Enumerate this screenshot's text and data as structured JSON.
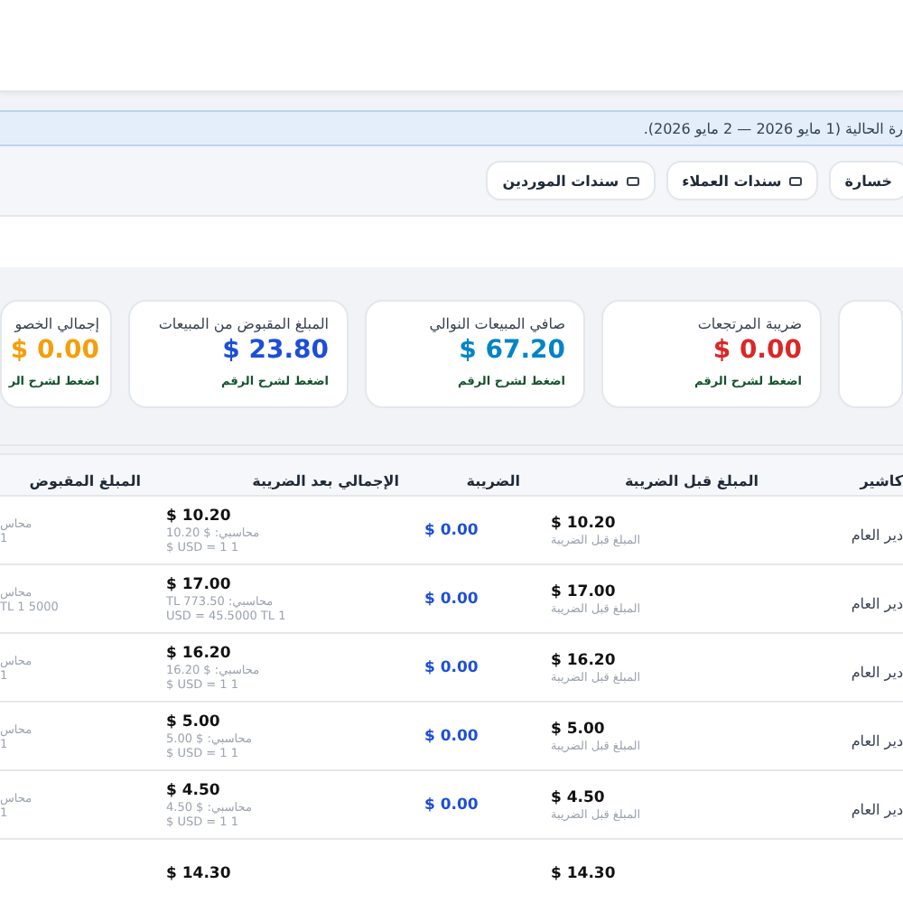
{
  "info_bar": {
    "text": "رة الحالية (1 مايو 2026 — 2 مايو 2026)."
  },
  "report_buttons": [
    {
      "label": "خسارة",
      "icon": false
    },
    {
      "label": "سندات العملاء",
      "icon": true
    },
    {
      "label": "سندات الموردين",
      "icon": true
    }
  ],
  "summary_cards": [
    {
      "kind": "blank"
    },
    {
      "kind": "stat",
      "label": "ضريبة المرتجعات",
      "value": "$ 0.00",
      "color": "#dc2626",
      "hint": "اضغط لشرح الرقم"
    },
    {
      "kind": "stat",
      "label": "صافي المبيعات النوالي",
      "value": "$ 67.20",
      "color": "#0284c7",
      "hint": "اضغط لشرح الرقم"
    },
    {
      "kind": "stat",
      "label": "المبلغ المقبوض من المبيعات",
      "value": "$ 23.80",
      "color": "#1d4ed8",
      "hint": "اضغط لشرح الرقم"
    },
    {
      "kind": "stat",
      "label": "إجمالي الخصو",
      "value": "$ 0.00",
      "color": "#f59e0b",
      "hint": "اضغط لشرح الر"
    }
  ],
  "table": {
    "columns": [
      "كاشير",
      "المبلغ قبل الضريبة",
      "الضريبة",
      "الإجمالي بعد الضريبة",
      "المبلغ المقبوض"
    ],
    "rows": [
      {
        "cashier": "دير العام",
        "before_tax": {
          "amount": "$ 10.20",
          "note": "المبلغ قبل الضريبة"
        },
        "tax": "$ 0.00",
        "after_tax": {
          "amount": "$ 10.20",
          "accounting": "محاسبي: $ 10.20",
          "rate": "$ USD = 1 1"
        },
        "received": [
          "محاس",
          "1"
        ]
      },
      {
        "cashier": "دير العام",
        "before_tax": {
          "amount": "$ 17.00",
          "note": "المبلغ قبل الضريبة"
        },
        "tax": "$ 0.00",
        "after_tax": {
          "amount": "$ 17.00",
          "accounting": "محاسبي: TL 773.50",
          "rate": "USD = 45.5000 TL 1"
        },
        "received": [
          "محاس",
          "5000 TL 1"
        ]
      },
      {
        "cashier": "دير العام",
        "before_tax": {
          "amount": "$ 16.20",
          "note": "المبلغ قبل الضريبة"
        },
        "tax": "$ 0.00",
        "after_tax": {
          "amount": "$ 16.20",
          "accounting": "محاسبي: $ 16.20",
          "rate": "$ USD = 1 1"
        },
        "received": [
          "محاس",
          "1"
        ]
      },
      {
        "cashier": "دير العام",
        "before_tax": {
          "amount": "$ 5.00",
          "note": "المبلغ قبل الضريبة"
        },
        "tax": "$ 0.00",
        "after_tax": {
          "amount": "$ 5.00",
          "accounting": "محاسبي: $ 5.00",
          "rate": "$ USD = 1 1"
        },
        "received": [
          "محاس",
          "1"
        ]
      },
      {
        "cashier": "دير العام",
        "before_tax": {
          "amount": "$ 4.50",
          "note": "المبلغ قبل الضريبة"
        },
        "tax": "$ 0.00",
        "after_tax": {
          "amount": "$ 4.50",
          "accounting": "محاسبي: $ 4.50",
          "rate": "$ USD = 1 1"
        },
        "received": [
          "محاس",
          "1"
        ]
      },
      {
        "before_tax": {
          "amount": "$ 14.30"
        },
        "after_tax": {
          "amount": "$ 14.30"
        }
      }
    ]
  }
}
